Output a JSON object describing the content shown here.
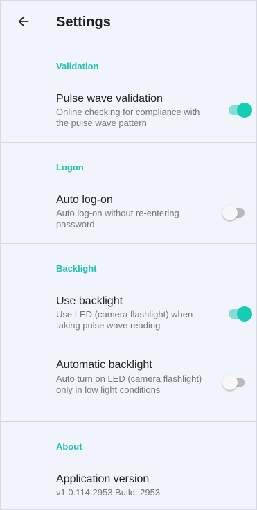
{
  "header": {
    "title": "Settings",
    "back_icon": "arrow-left-icon"
  },
  "colors": {
    "accent": "#20c2b0",
    "switch_on_thumb": "#14cdb4",
    "switch_on_track": "#86ddd3",
    "background": "#f1f5fb"
  },
  "sections": {
    "validation": {
      "header": "Validation",
      "pulse_wave": {
        "title": "Pulse wave validation",
        "summary": "Online checking for compliance with the pulse wave pattern",
        "enabled": true
      }
    },
    "logon": {
      "header": "Logon",
      "auto_logon": {
        "title": "Auto log-on",
        "summary": "Auto log-on without re-entering password",
        "enabled": false
      }
    },
    "backlight": {
      "header": "Backlight",
      "use_backlight": {
        "title": "Use backlight",
        "summary": "Use LED (camera flashlight) when taking pulse wave reading",
        "enabled": true
      },
      "auto_backlight": {
        "title": "Automatic backlight",
        "summary": "Auto turn on LED (camera flashlight) only in low light conditions",
        "enabled": false
      }
    },
    "about": {
      "header": "About",
      "app_version": {
        "title": "Application version",
        "summary": "v1.0.114.2953 Build: 2953"
      }
    }
  }
}
